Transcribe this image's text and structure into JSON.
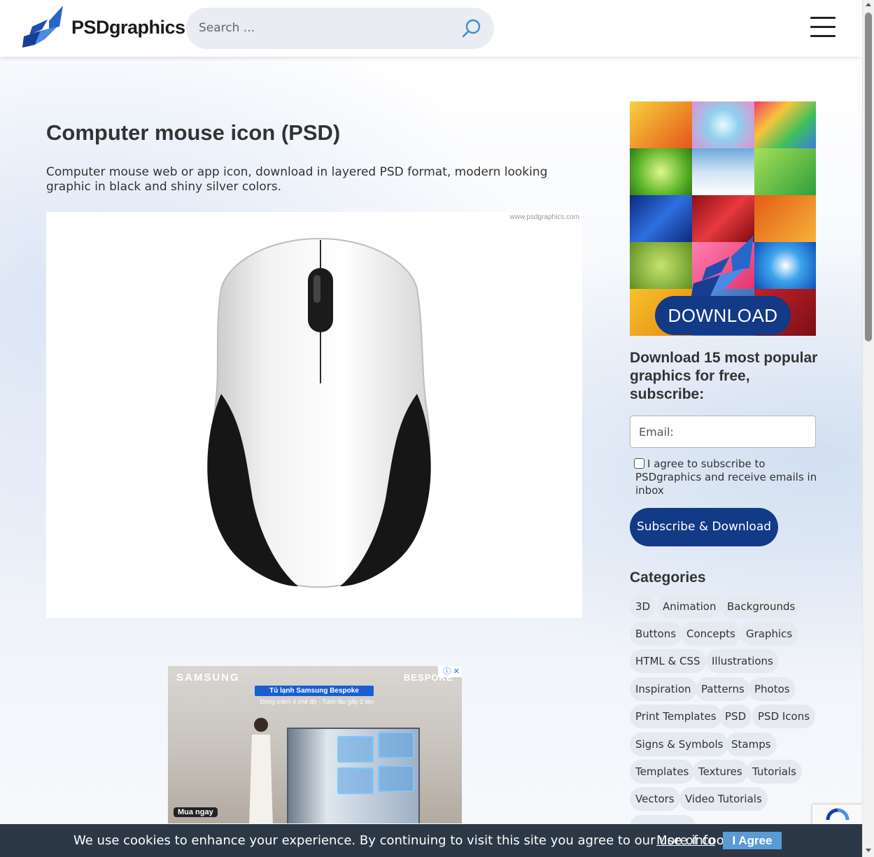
{
  "header": {
    "logo_text": "PSDgraphics",
    "search_placeholder": "Search ..."
  },
  "main": {
    "title": "Computer mouse icon (PSD)",
    "description": "Computer mouse web or app icon, download in layered PSD format, modern looking graphic in black and shiny silver colors.",
    "watermark": "www.psdgraphics.com"
  },
  "ad": {
    "brand": "SAMSUNG",
    "brand_line": "BESPOKE",
    "headline": "Tủ lạnh Samsung Bespoke",
    "subline": "Đóng mềm 4 chế độ - Tươi lâu gấp 2 lần",
    "cta": "Mua ngay",
    "close_label": "ⓘ ✕"
  },
  "sidebar": {
    "promo_button": "DOWNLOAD",
    "subscribe_title": "Download 15 most popular graphics for free, subscribe:",
    "email_placeholder": "Email:",
    "agree_text": "I agree to subscribe to PSDgraphics and receive emails in inbox",
    "subscribe_button": "Subscribe & Download",
    "categories_title": "Categories",
    "categories": [
      "3D",
      "Animation",
      "Backgrounds",
      "Buttons",
      "Concepts",
      "Graphics",
      "HTML & CSS",
      "Illustrations",
      "Inspiration",
      "Patterns",
      "Photos",
      "Print Templates",
      "PSD",
      "PSD Icons",
      "Signs & Symbols",
      "Stamps",
      "Templates",
      "Textures",
      "Tutorials",
      "Vectors",
      "Video Tutorials"
    ]
  },
  "cookie": {
    "text": "We use cookies to enhance your experience. By continuing to visit this site you agree to our use of cookies.",
    "link": "More info",
    "button": "I Agree"
  },
  "colors": {
    "brand_navy": "#123a86",
    "chip_bg": "#e5e9f0",
    "cookie_bg": "#2c3846",
    "cookie_button": "#5b9bd5"
  }
}
